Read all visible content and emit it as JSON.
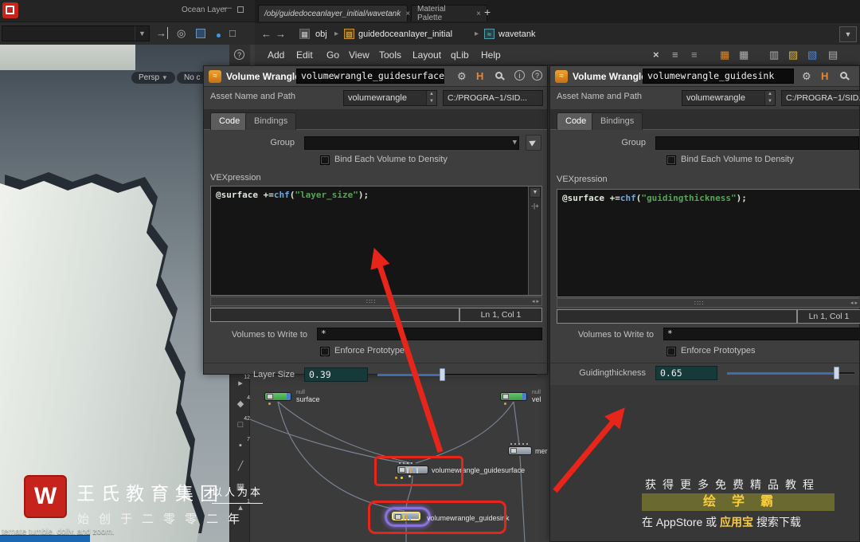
{
  "topbar": {
    "pane_label": "Ocean Layer",
    "tabs": [
      {
        "label": "/obj/guidedoceanlayer_initial/wavetank"
      },
      {
        "label": "Material Palette"
      }
    ]
  },
  "pathbar": {
    "crumbs": [
      "obj",
      "guidedoceanlayer_initial",
      "wavetank"
    ]
  },
  "menubar": {
    "items": [
      "Add",
      "Edit",
      "Go",
      "View",
      "Tools",
      "Layout",
      "qLib",
      "Help"
    ]
  },
  "labels": {
    "panel_title": "Volume Wrangle",
    "asset": "Asset Name and Path",
    "tab_code": "Code",
    "tab_bindings": "Bindings",
    "group": "Group",
    "bind_density": "Bind Each Volume to Density",
    "vex": "VEXpression",
    "status": "Ln 1, Col 1",
    "volumes": "Volumes to Write to",
    "enforce": "Enforce Prototypes"
  },
  "panels": {
    "left": {
      "name": "volumewrangle_guidesurface",
      "asset_type": "volumewrangle",
      "asset_path": "C:/PROGRA~1/SID...",
      "code_pre": "@surface +=",
      "code_func": "chf",
      "code_open": "(",
      "code_string": "\"layer_size\"",
      "code_close": ");",
      "volumes_value": "*",
      "param_label": "Layer Size",
      "param_value": "0.39"
    },
    "right": {
      "name": "volumewrangle_guidesink",
      "asset_type": "volumewrangle",
      "asset_path": "C:/PROGRA~1/SID...",
      "code_pre": "@surface +=",
      "code_func": "chf",
      "code_open": "(",
      "code_string": "\"guidingthickness\"",
      "code_close": ");",
      "volumes_value": "*",
      "param_label": "Guidingthickness",
      "param_value": "0.65"
    }
  },
  "viewport": {
    "persp_label": "Persp",
    "cam_label": "No c",
    "hint": "ternate tumble, dolly, and zoom."
  },
  "network": {
    "toolbar_nums": [
      "12",
      "4",
      "42",
      "7",
      "1"
    ],
    "nodes": {
      "surface": {
        "type": "null",
        "name": "surface"
      },
      "vel": {
        "type": "null",
        "name": "vel"
      },
      "merge": {
        "name": "mer"
      },
      "guidesurface": {
        "name": "volumewrangle_guidesurface"
      },
      "guidesink": {
        "name": "volumewrangle_guidesink"
      }
    }
  },
  "watermark": {
    "logo": "W",
    "company": "王氏教育集团",
    "slogan": "以人为本",
    "founded": "始创于二零零二年"
  },
  "promo": {
    "line1": "获得更多免费精品教程",
    "brand": "绘学霸",
    "line2_a": "在",
    "line2_store": "AppStore",
    "line2_b": "或",
    "line2_app": "应用宝",
    "line2_c": "搜索下载"
  },
  "colors": {
    "accent_red": "#e8251a",
    "node_green": "#49b050",
    "slider_blue": "#3e6cae",
    "brand_yellow": "#f7cd3f"
  }
}
